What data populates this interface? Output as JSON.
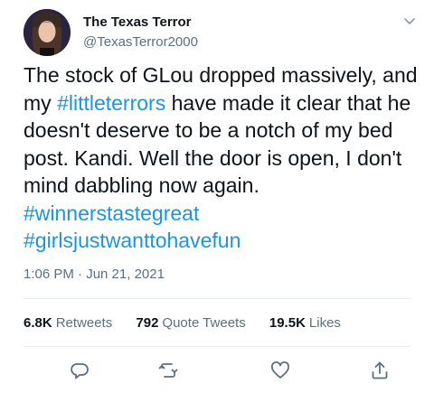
{
  "author": {
    "display_name": "The Texas Terror",
    "handle": "@TexasTerror2000"
  },
  "tweet": {
    "text_part1": "The stock of GLou dropped massively, and my ",
    "hashtag1": "#littleterrors",
    "text_part2": " have made it clear that he doesn't deserve to be a notch of my bed post. Kandi. Well the door is open, I don't mind dabbling now again. ",
    "hashtag2": "#winnerstastegreat",
    "hashtag3": "#girlsjustwanttohavefun"
  },
  "meta": {
    "timestamp": "1:06 PM · Jun 21, 2021"
  },
  "stats": {
    "retweets_count": "6.8K",
    "retweets_label": "Retweets",
    "quotes_count": "792",
    "quotes_label": "Quote Tweets",
    "likes_count": "19.5K",
    "likes_label": "Likes"
  },
  "icons": {
    "more": "chevron-down-icon",
    "reply": "reply-icon",
    "retweet": "retweet-icon",
    "like": "heart-icon",
    "share": "share-icon"
  },
  "colors": {
    "hashtag": "#1b95e0",
    "secondary_text": "#5b7083",
    "primary_text": "#0f1419",
    "divider": "#e6ecf0"
  }
}
